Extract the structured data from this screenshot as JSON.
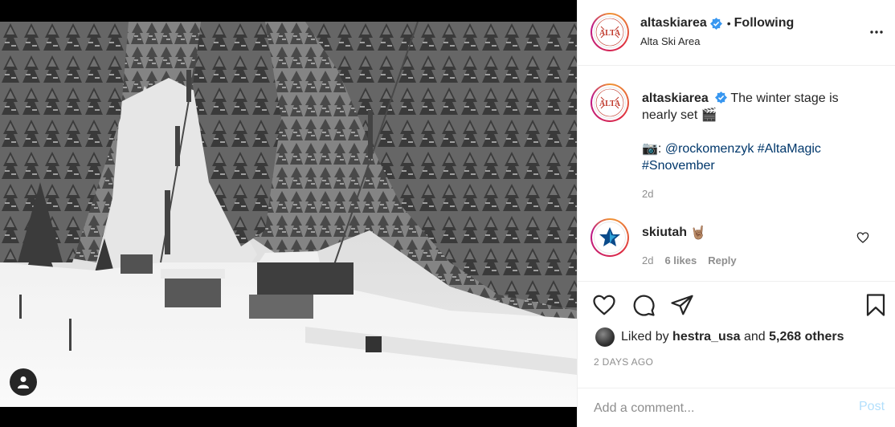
{
  "header": {
    "username": "altaskiarea",
    "dot": "•",
    "follow_status": "Following",
    "location": "Alta Ski Area",
    "avatar_text": "ALTA"
  },
  "caption": {
    "username": "altaskiarea",
    "text_line1": "The winter stage is nearly set 🎬",
    "camera_emoji": "📷",
    "colon": ":",
    "mention": "@rockomenzyk",
    "hashtags": [
      "#AltaMagic",
      "#Snovember"
    ],
    "time": "2d"
  },
  "comment": {
    "username": "skiutah",
    "emoji": "🤘🏽",
    "time": "2d",
    "likes": "6 likes",
    "reply": "Reply"
  },
  "likes": {
    "prefix": "Liked by",
    "user": "hestra_usa",
    "conj": "and",
    "others": "5,268 others"
  },
  "time_ago": "2 DAYS AGO",
  "add_comment": {
    "placeholder": "Add a comment...",
    "post_label": "Post"
  },
  "colors": {
    "link": "#00376b",
    "verified": "#3897f0",
    "post_disabled": "#b2dffc"
  },
  "icons": [
    "more-options-icon",
    "heart-icon",
    "comment-icon",
    "share-icon",
    "bookmark-icon",
    "user-tag-icon",
    "verified-icon"
  ]
}
